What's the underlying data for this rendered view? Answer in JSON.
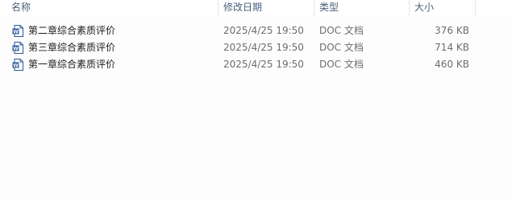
{
  "columns": {
    "name": "名称",
    "date": "修改日期",
    "type": "类型",
    "size": "大小"
  },
  "files": [
    {
      "name": "第二章综合素质评价",
      "date": "2025/4/25 19:50",
      "type": "DOC 文档",
      "size": "376 KB",
      "icon": "word-doc-icon"
    },
    {
      "name": "第三章综合素质评价",
      "date": "2025/4/25 19:50",
      "type": "DOC 文档",
      "size": "714 KB",
      "icon": "word-doc-icon"
    },
    {
      "name": "第一章综合素质评价",
      "date": "2025/4/25 19:50",
      "type": "DOC 文档",
      "size": "460 KB",
      "icon": "word-doc-icon"
    }
  ],
  "colors": {
    "header_text": "#4c607a",
    "icon_blue": "#2b5797",
    "secondary_text": "#6d6d6d"
  }
}
